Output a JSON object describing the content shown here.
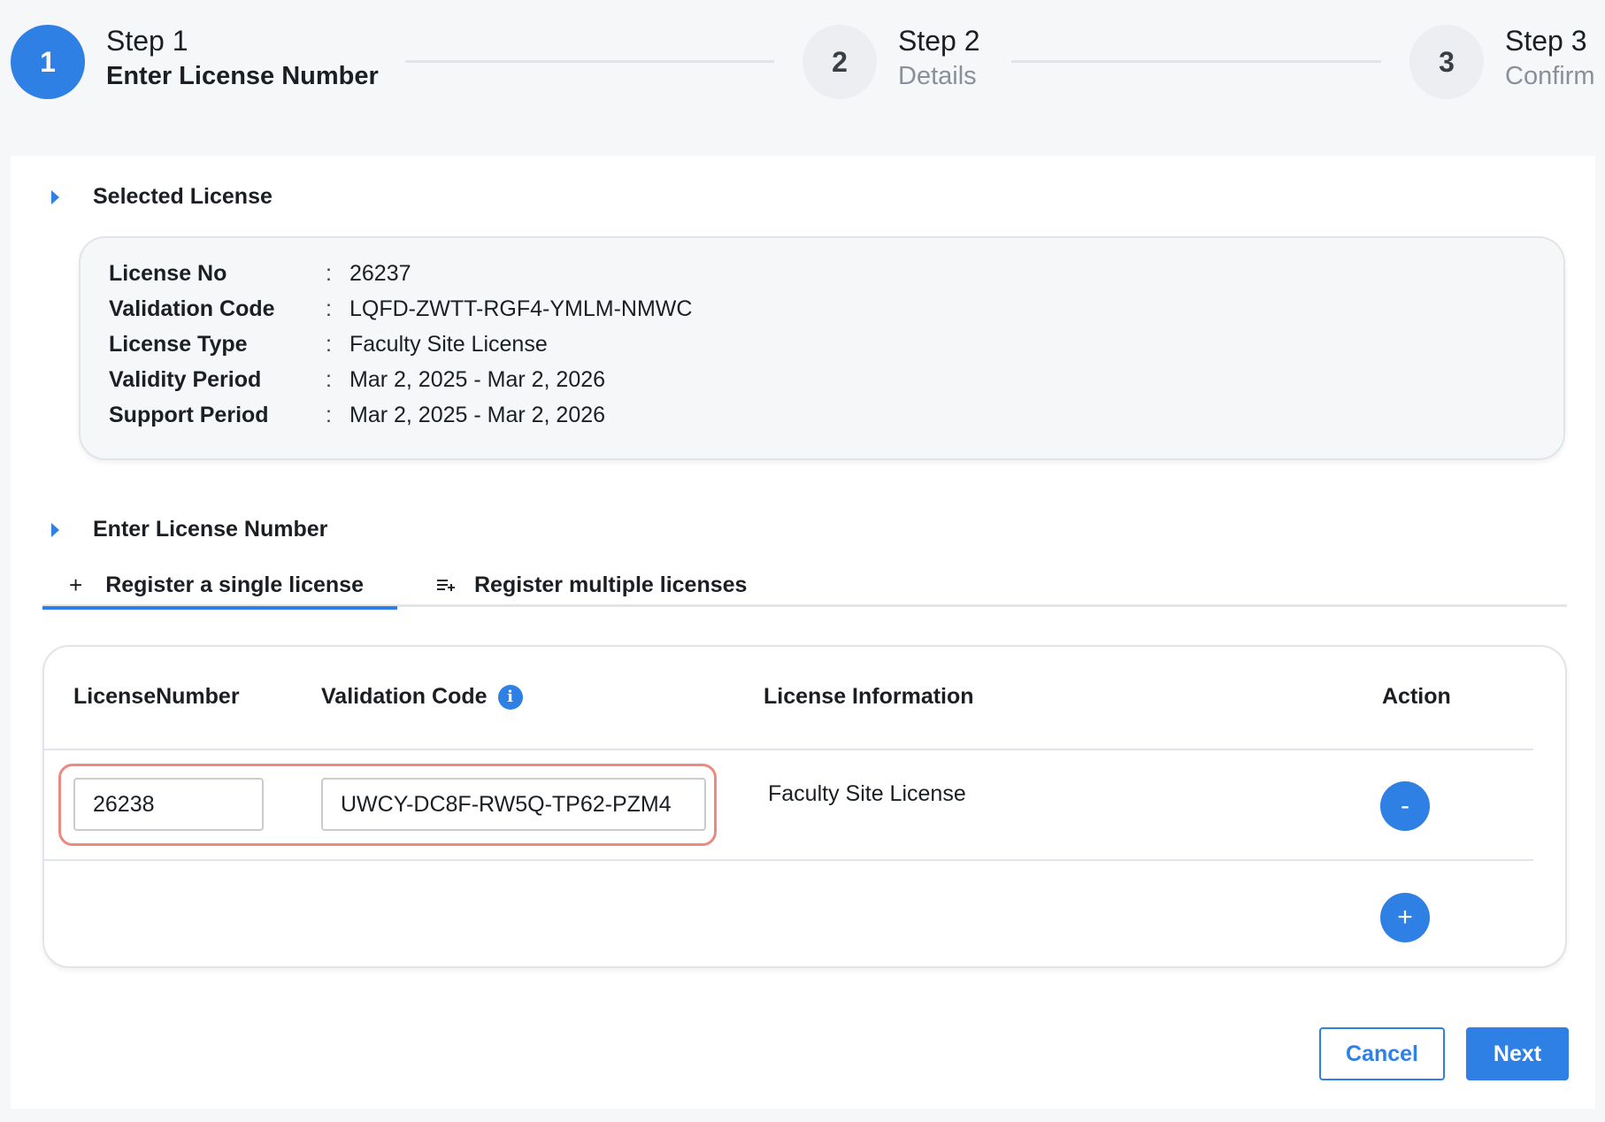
{
  "stepper": {
    "steps": [
      {
        "number": "1",
        "title": "Step 1",
        "subtitle": "Enter License Number"
      },
      {
        "number": "2",
        "title": "Step 2",
        "subtitle": "Details"
      },
      {
        "number": "3",
        "title": "Step 3",
        "subtitle": "Confirm"
      }
    ],
    "active_step": 1
  },
  "selected_license": {
    "section_title": "Selected License",
    "rows": [
      {
        "label": "License No",
        "value": "26237"
      },
      {
        "label": "Validation Code",
        "value": "LQFD-ZWTT-RGF4-YMLM-NMWC"
      },
      {
        "label": "License Type",
        "value": "Faculty Site License"
      },
      {
        "label": "Validity Period",
        "value": "Mar 2, 2025 - Mar 2, 2026"
      },
      {
        "label": "Support Period",
        "value": "Mar 2, 2025 - Mar 2, 2026"
      }
    ],
    "colon": ":"
  },
  "enter_license": {
    "section_title": "Enter License Number",
    "tabs": [
      {
        "label": "Register a single license",
        "icon": "plus-icon",
        "icon_glyph": "+"
      },
      {
        "label": "Register multiple licenses",
        "icon": "playlist-add-icon"
      }
    ],
    "table": {
      "headers": {
        "license_number": "LicenseNumber",
        "validation_code": "Validation Code",
        "license_information": "License Information",
        "action": "Action"
      },
      "info_glyph": "i",
      "rows": [
        {
          "license_number": "26238",
          "validation_code": "UWCY-DC8F-RW5Q-TP62-PZM4",
          "license_information": "Faculty Site License",
          "remove_glyph": "-"
        }
      ],
      "add_glyph": "+"
    }
  },
  "footer": {
    "cancel_label": "Cancel",
    "next_label": "Next"
  },
  "colors": {
    "accent": "#2f80e5",
    "highlight": "#ec8a80"
  }
}
